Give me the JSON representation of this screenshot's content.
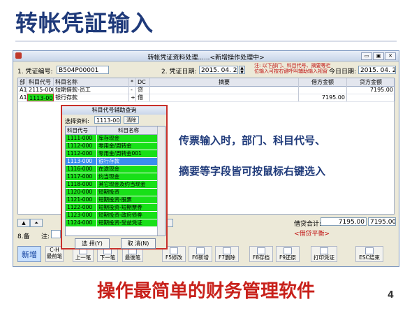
{
  "slide": {
    "title": "转帐凭証输入",
    "bottom_title": "操作最简单的财务管理软件",
    "page_number": "4",
    "callout_line1": "传票输入时，部门、科目代号、",
    "callout_line2": "摘要等字段皆可按鼠标右键选入"
  },
  "window": {
    "title": "转帐凭证资料处理......<新增操作处理中>",
    "voucher_no_label": "1. 凭证编号:",
    "voucher_no_value": "B504P00001",
    "voucher_date_label": "2. 凭证日期:",
    "voucher_date_value": "2015. 04. 22",
    "note": "注: 以下部门、科目代号、摘要等栏位输入可按右键呼叫辅助输入视窗",
    "today_label": "今日日期:",
    "today_value": "2015. 04. 22",
    "buttons": {
      "minimize": "▭",
      "restore": "▣",
      "close": "✕"
    }
  },
  "grid": {
    "headers": [
      "部",
      "科目代号",
      "科目名称",
      "*",
      "DC",
      "摘要",
      "借方金额",
      "贷方金额"
    ],
    "rows": [
      {
        "dept": "A1",
        "code": "2115-000",
        "name": "短期借款-员工",
        "star": "-",
        "dc": "贷",
        "summary": "",
        "debit": "",
        "credit": "7195.00"
      },
      {
        "dept": "A1",
        "code": "1113-000",
        "name": "银行存款",
        "star": "+",
        "dc": "借",
        "summary": "",
        "debit": "7195.00",
        "credit": ""
      }
    ]
  },
  "popup": {
    "title": "科目代号辅助查询",
    "select_label": "选择资料:",
    "select_value": "1113-000",
    "clear_label": "清除",
    "col_code": "科目代号",
    "col_name": "科目名称",
    "rows": [
      {
        "code": "1111-000",
        "name": "库存现金"
      },
      {
        "code": "1112-000",
        "name": "零用金/周转金"
      },
      {
        "code": "1112-000",
        "name": "零用金/周转金001"
      },
      {
        "code": "1113-000",
        "name": "银行存款",
        "selected": true
      },
      {
        "code": "1116-000",
        "name": "在途现金"
      },
      {
        "code": "1117-000",
        "name": "约当现金"
      },
      {
        "code": "1118-000",
        "name": "其它现金及约当现金"
      },
      {
        "code": "1120-000",
        "name": "短期投资"
      },
      {
        "code": "1121-000",
        "name": "短期投资-股票"
      },
      {
        "code": "1122-000",
        "name": "短期投资-短期票券"
      },
      {
        "code": "1123-000",
        "name": "短期投资-政府债券"
      },
      {
        "code": "1124-000",
        "name": "短期投资-受益凭证"
      }
    ],
    "ok_label": "选 择(Y)",
    "cancel_label": "取 消(N)"
  },
  "footer": {
    "total_label": "借贷合计:",
    "debit_total": "7195.00",
    "credit_total": "7195.00",
    "balance_status": "<借贷平衡>",
    "remark_label": "8.备",
    "remark_label2": "注:",
    "partial_button": "笔"
  },
  "toolbar": {
    "new": "新增",
    "first": "最前笔",
    "prev": "上一笔",
    "next": "下一笔",
    "last": "最後笔",
    "modify": "F5修改",
    "add": "F6新增",
    "delete": "F7删除",
    "save": "F8存档",
    "restore": "F9还原",
    "print": "打印凭证",
    "exit": "ESC结束",
    "first_hint": "C-H"
  }
}
